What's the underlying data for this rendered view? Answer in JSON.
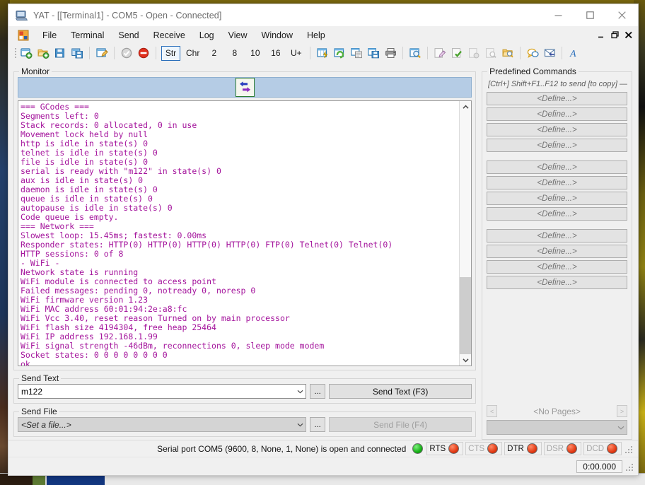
{
  "window": {
    "title": "YAT - [[Terminal1] - COM5 - Open - Connected]",
    "app_icon": "computer-icon",
    "minimize": "—",
    "maximize": "☐",
    "close": "✕"
  },
  "mdi": {
    "restore_icon": "mdi-restore-icon",
    "minimize_label": "_",
    "restore_label": "❐",
    "close_label": "✕"
  },
  "menu": {
    "items": [
      {
        "label": "File"
      },
      {
        "label": "Terminal"
      },
      {
        "label": "Send"
      },
      {
        "label": "Receive"
      },
      {
        "label": "Log"
      },
      {
        "label": "View"
      },
      {
        "label": "Window"
      },
      {
        "label": "Help"
      }
    ]
  },
  "toolbar": {
    "icons_left": [
      {
        "name": "new-terminal-icon"
      },
      {
        "name": "open-terminal-icon"
      },
      {
        "name": "save-terminal-icon"
      },
      {
        "name": "save-workspace-icon"
      }
    ],
    "icons_edit": [
      {
        "name": "edit-terminal-settings-icon"
      }
    ],
    "icons_state": [
      {
        "name": "open-close-terminal-icon"
      },
      {
        "name": "stop-terminal-icon"
      }
    ],
    "radix": [
      {
        "label": "Str",
        "selected": true
      },
      {
        "label": "Chr",
        "selected": false
      },
      {
        "label": "2",
        "selected": false
      },
      {
        "label": "8",
        "selected": false
      },
      {
        "label": "10",
        "selected": false
      },
      {
        "label": "16",
        "selected": false
      },
      {
        "label": "U+",
        "selected": false
      }
    ],
    "icons_right": [
      {
        "name": "clear-monitor-icon"
      },
      {
        "name": "refresh-monitor-icon"
      },
      {
        "name": "copy-monitor-icon"
      },
      {
        "name": "save-monitor-icon"
      },
      {
        "name": "print-monitor-icon"
      },
      {
        "name": "find-icon"
      },
      {
        "name": "log-edit-icon"
      },
      {
        "name": "log-on-icon"
      },
      {
        "name": "log-clear-icon"
      },
      {
        "name": "log-view-icon"
      },
      {
        "name": "log-open-folder-icon"
      },
      {
        "name": "chat-icon"
      },
      {
        "name": "autoresponse-icon"
      },
      {
        "name": "format-font-icon"
      }
    ]
  },
  "monitor": {
    "group_title": "Monitor",
    "direction_icon": "bidirectional-arrows-icon",
    "lines": [
      "=== GCodes ===",
      "Segments left: 0",
      "Stack records: 0 allocated, 0 in use",
      "Movement lock held by null",
      "http is idle in state(s) 0",
      "telnet is idle in state(s) 0",
      "file is idle in state(s) 0",
      "serial is ready with \"m122\" in state(s) 0",
      "aux is idle in state(s) 0",
      "daemon is idle in state(s) 0",
      "queue is idle in state(s) 0",
      "autopause is idle in state(s) 0",
      "Code queue is empty.",
      "=== Network ===",
      "Slowest loop: 15.45ms; fastest: 0.00ms",
      "Responder states: HTTP(0) HTTP(0) HTTP(0) HTTP(0) FTP(0) Telnet(0) Telnet(0)",
      "HTTP sessions: 0 of 8",
      "- WiFi -",
      "Network state is running",
      "WiFi module is connected to access point",
      "Failed messages: pending 0, notready 0, noresp 0",
      "WiFi firmware version 1.23",
      "WiFi MAC address 60:01:94:2e:a8:fc",
      "WiFi Vcc 3.40, reset reason Turned on by main processor",
      "WiFi flash size 4194304, free heap 25464",
      "WiFi IP address 192.168.1.99",
      "WiFi signal strength -46dBm, reconnections 0, sleep mode modem",
      "Socket states: 0 0 0 0 0 0 0 0",
      "ok"
    ],
    "text_color": "#a4149c",
    "scroll_up_icon": "chevron-up-icon",
    "scroll_down_icon": "chevron-down-icon"
  },
  "send_text": {
    "group_title": "Send Text",
    "value": "m122",
    "placeholder": "",
    "dropdown_icon": "chevron-down-icon",
    "browse_label": "...",
    "button_label": "Send Text (F3)"
  },
  "send_file": {
    "group_title": "Send File",
    "value": "<Set a file...>",
    "dropdown_icon": "chevron-down-icon",
    "browse_label": "...",
    "button_label": "Send File (F4)",
    "disabled": true
  },
  "predefined": {
    "group_title": "Predefined Commands",
    "hint": "[Ctrl+] Shift+F1..F12 to send [to copy] —",
    "groups": [
      [
        "<Define...>",
        "<Define...>",
        "<Define...>",
        "<Define...>"
      ],
      [
        "<Define...>",
        "<Define...>",
        "<Define...>",
        "<Define...>"
      ],
      [
        "<Define...>",
        "<Define...>",
        "<Define...>",
        "<Define...>"
      ]
    ],
    "prev_label": "<",
    "next_label": ">",
    "pages_label": "<No Pages>",
    "select_value": "",
    "select_icon": "chevron-down-icon"
  },
  "status": {
    "message": "Serial port COM5 (9600, 8, None, 1, None) is open and connected",
    "connection_led": "green",
    "signals": [
      {
        "label": "RTS",
        "led": "red",
        "dim": false
      },
      {
        "label": "CTS",
        "led": "red",
        "dim": true
      },
      {
        "label": "DTR",
        "led": "red",
        "dim": false
      },
      {
        "label": "DSR",
        "led": "red",
        "dim": true
      },
      {
        "label": "DCD",
        "led": "red",
        "dim": true
      }
    ]
  },
  "bottom": {
    "timer": "0:00.000",
    "resize_grip": "resize-grip-icon"
  },
  "colors": {
    "accent": "#2a6fbb",
    "terminal_text": "#a4149c",
    "monitor_strip": "#b5cce5",
    "led_green": "#17b117",
    "led_red": "#e33a14"
  }
}
